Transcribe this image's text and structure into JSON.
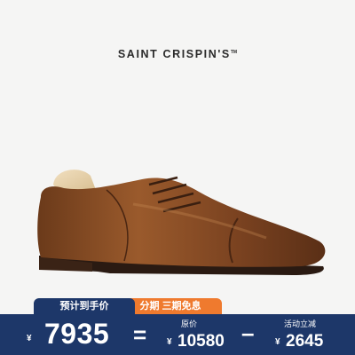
{
  "brand": {
    "name": "SAINT CRISPIN'S",
    "tm": "TM"
  },
  "product": {
    "icon": "oxford-shoe"
  },
  "price": {
    "tag_left": "预计到手价",
    "tag_mid": "分期 三期免息",
    "currency": "¥",
    "sale_value": "7935",
    "equals": "=",
    "original_label": "原价",
    "original_value": "10580",
    "minus": "–",
    "discount_label": "活动立减",
    "discount_value": "2645"
  },
  "colors": {
    "bar": "#1d3769",
    "accent": "#ef7a2e",
    "background": "#f5f5f4"
  }
}
